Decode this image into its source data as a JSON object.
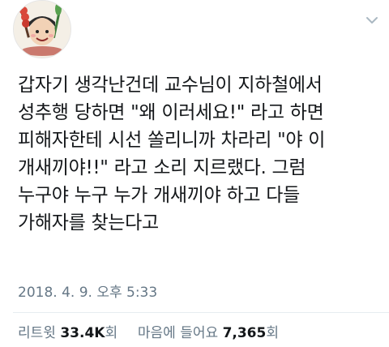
{
  "tweet": {
    "lines": [
      "갑자기 생각난건데 교수님이 지하철에서",
      "성추행 당하면 \"왜 이러세요!\" 라고 하면",
      "피해자한테 시선 쏠리니까 차라리 \"야 이",
      "개새끼야!!\" 라고 소리 지르랬다. 그럼",
      "누구야 누구 누가 개새끼야 하고 다들",
      "가해자를 찾는다고"
    ],
    "timestamp": "2018. 4. 9. 오후 5:33"
  },
  "stats": {
    "retweet_label": "리트윗",
    "retweet_count": "33.4K",
    "retweet_unit": "회",
    "likes_label": "마음에 들어요",
    "likes_count": "7,365",
    "likes_unit": "회"
  },
  "icons": {
    "avatar": "cartoon-avatar",
    "menu": "chevron-down-icon"
  },
  "colors": {
    "text": "#14171a",
    "muted": "#657786",
    "divider": "#e6ecf0"
  }
}
